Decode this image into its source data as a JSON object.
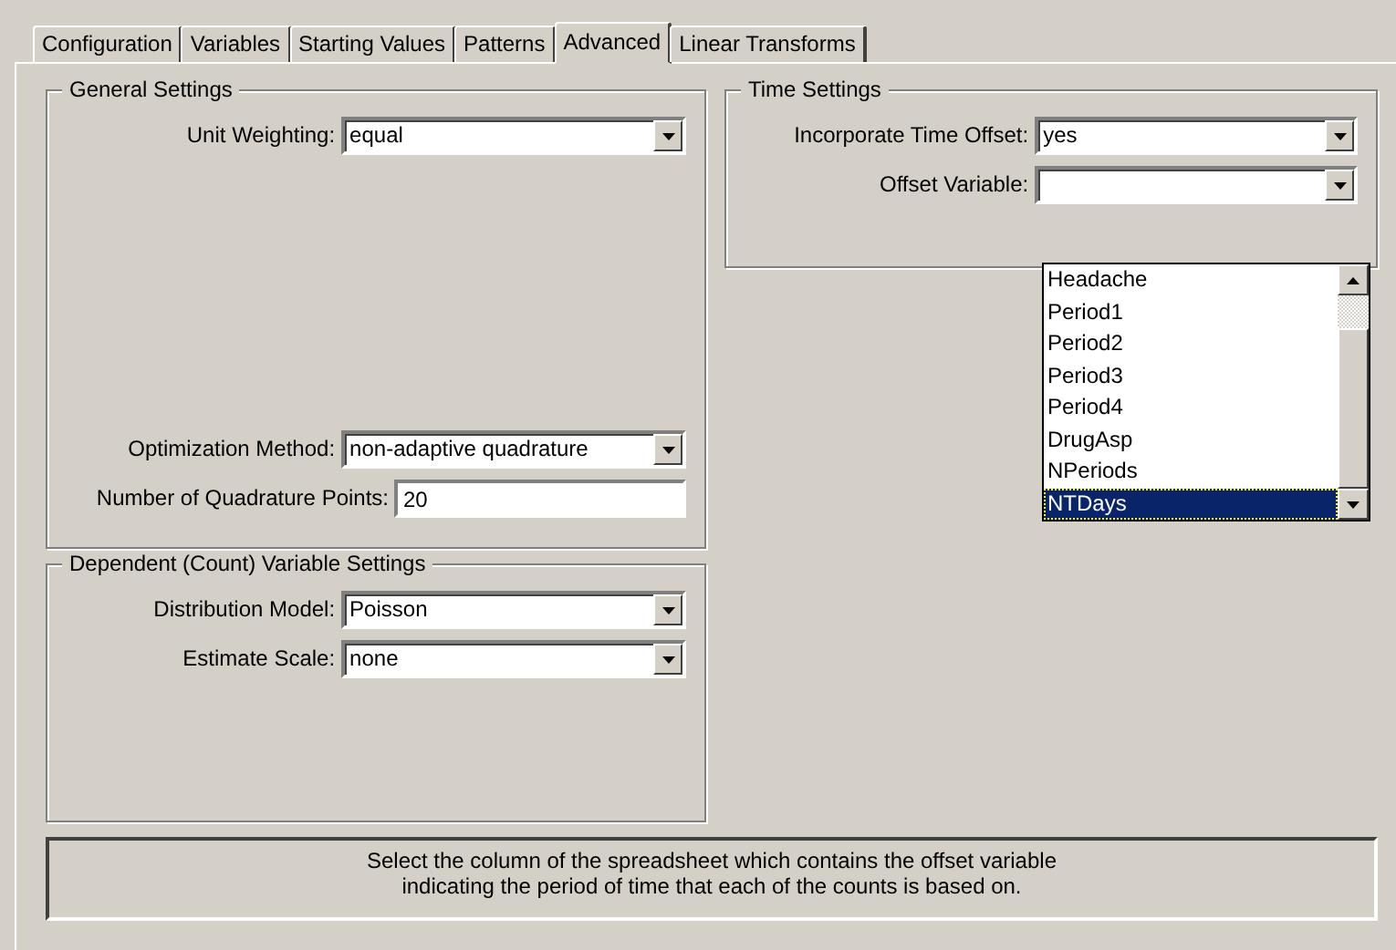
{
  "tabs": [
    {
      "label": "Configuration",
      "selected": false
    },
    {
      "label": "Variables",
      "selected": false
    },
    {
      "label": "Starting Values",
      "selected": false
    },
    {
      "label": "Patterns",
      "selected": false
    },
    {
      "label": "Advanced",
      "selected": true
    },
    {
      "label": "Linear Transforms",
      "selected": false
    }
  ],
  "general_settings": {
    "title": "General Settings",
    "unit_weighting": {
      "label": "Unit Weighting:",
      "value": "equal"
    },
    "optimization_method": {
      "label": "Optimization Method:",
      "value": "non-adaptive quadrature"
    },
    "quadrature_points": {
      "label": "Number of Quadrature Points:",
      "value": "20"
    }
  },
  "dependent_settings": {
    "title": "Dependent (Count) Variable Settings",
    "distribution_model": {
      "label": "Distribution Model:",
      "value": "Poisson"
    },
    "estimate_scale": {
      "label": "Estimate Scale:",
      "value": "none"
    }
  },
  "time_settings": {
    "title": "Time Settings",
    "incorporate_time_offset": {
      "label": "Incorporate Time Offset:",
      "value": "yes"
    },
    "offset_variable": {
      "label": "Offset Variable:",
      "expanded": true,
      "options": [
        {
          "label": "Headache",
          "selected": false
        },
        {
          "label": "Period1",
          "selected": false
        },
        {
          "label": "Period2",
          "selected": false
        },
        {
          "label": "Period3",
          "selected": false
        },
        {
          "label": "Period4",
          "selected": false
        },
        {
          "label": "DrugAsp",
          "selected": false
        },
        {
          "label": "NPeriods",
          "selected": false
        },
        {
          "label": "NTDays",
          "selected": true
        }
      ]
    }
  },
  "status_text": "Select the column of the spreadsheet which contains the offset variable\nindicating the period of time that each of the counts is based on."
}
